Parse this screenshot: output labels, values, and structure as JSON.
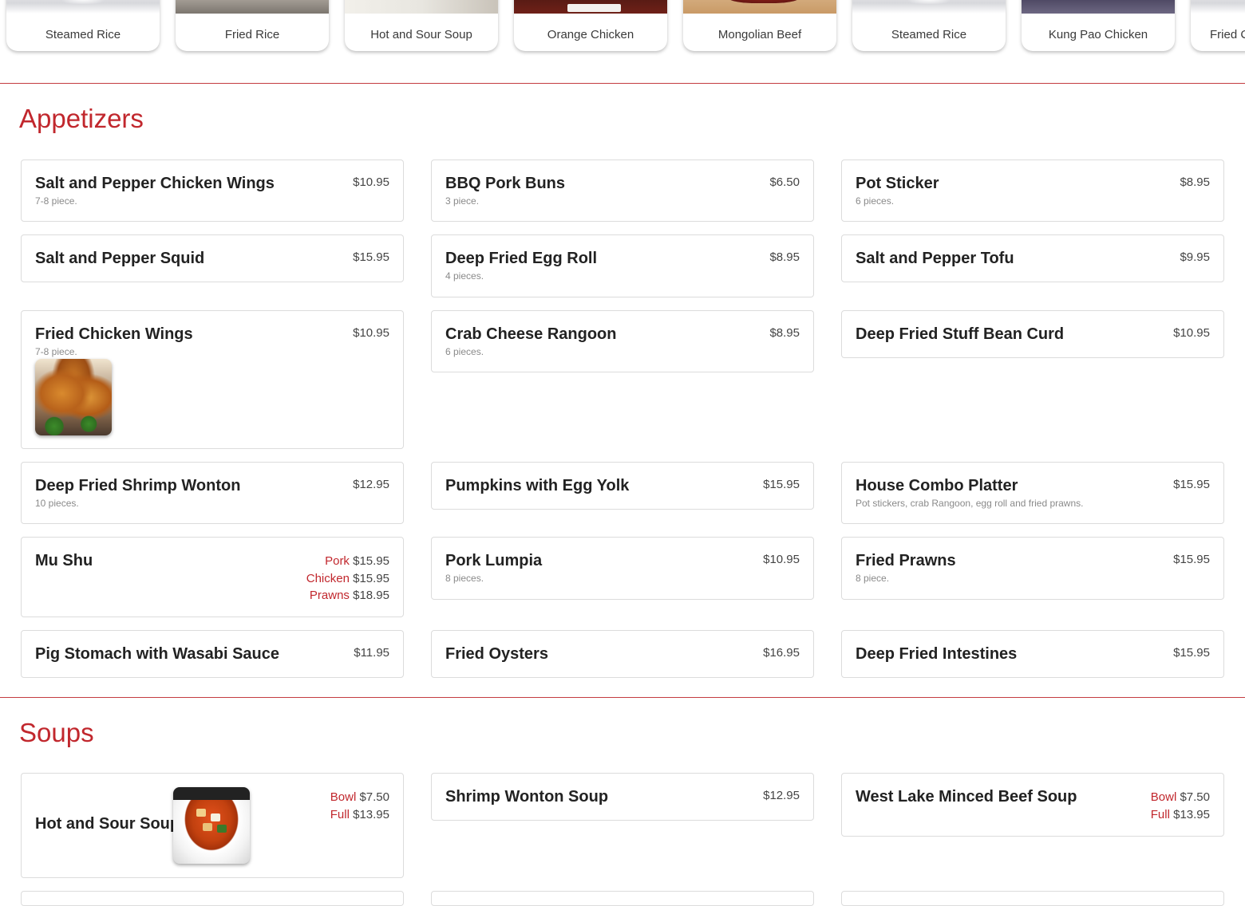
{
  "carousel": {
    "items": [
      {
        "label": "Steamed Rice",
        "thumb": "plate"
      },
      {
        "label": "Fried Rice",
        "thumb": "fried"
      },
      {
        "label": "Hot and Sour Soup",
        "thumb": "soup"
      },
      {
        "label": "Orange Chicken",
        "thumb": "orange"
      },
      {
        "label": "Mongolian Beef",
        "thumb": "beef"
      },
      {
        "label": "Steamed Rice",
        "thumb": "plate"
      },
      {
        "label": "Kung Pao Chicken",
        "thumb": "kungpao"
      },
      {
        "label": "Fried C",
        "thumb": "plate"
      }
    ]
  },
  "sections": {
    "appetizers": {
      "title": "Appetizers",
      "items": [
        {
          "name": "Salt and Pepper Chicken Wings",
          "desc": "7-8 piece.",
          "price": "$10.95"
        },
        {
          "name": "BBQ Pork Buns",
          "desc": "3 piece.",
          "price": "$6.50"
        },
        {
          "name": "Pot Sticker",
          "desc": "6 pieces.",
          "price": "$8.95"
        },
        {
          "name": "Salt and Pepper Squid",
          "price": "$15.95"
        },
        {
          "name": "Deep Fried Egg Roll",
          "desc": "4 pieces.",
          "price": "$8.95"
        },
        {
          "name": "Salt and Pepper Tofu",
          "price": "$9.95"
        },
        {
          "name": "Fried Chicken Wings",
          "desc": "7-8 piece.",
          "price": "$10.95",
          "image": "fried-chicken-wings-photo"
        },
        {
          "name": "Crab Cheese Rangoon",
          "desc": "6 pieces.",
          "price": "$8.95"
        },
        {
          "name": "Deep Fried Stuff Bean Curd",
          "price": "$10.95"
        },
        {
          "name": "Deep Fried Shrimp Wonton",
          "desc": "10 pieces.",
          "price": "$12.95"
        },
        {
          "name": "Pumpkins with Egg Yolk",
          "price": "$15.95"
        },
        {
          "name": "House Combo Platter",
          "desc": "Pot stickers, crab Rangoon, egg roll and fried prawns.",
          "price": "$15.95"
        },
        {
          "name": "Mu Shu",
          "options": [
            {
              "label": "Pork",
              "price": "$15.95"
            },
            {
              "label": "Chicken",
              "price": "$15.95"
            },
            {
              "label": "Prawns",
              "price": "$18.95"
            }
          ]
        },
        {
          "name": "Pork Lumpia",
          "desc": "8 pieces.",
          "price": "$10.95"
        },
        {
          "name": "Fried Prawns",
          "desc": "8 piece.",
          "price": "$15.95"
        },
        {
          "name": "Pig Stomach with Wasabi Sauce",
          "price": "$11.95"
        },
        {
          "name": "Fried Oysters",
          "price": "$16.95"
        },
        {
          "name": "Deep Fried Intestines",
          "price": "$15.95"
        }
      ]
    },
    "soups": {
      "title": "Soups",
      "items": [
        {
          "name": "Hot and Sour Soup",
          "image": "hot-and-sour-soup-photo",
          "options": [
            {
              "label": "Bowl",
              "price": "$7.50"
            },
            {
              "label": "Full",
              "price": "$13.95"
            }
          ]
        },
        {
          "name": "Shrimp Wonton Soup",
          "price": "$12.95"
        },
        {
          "name": "West Lake Minced Beef Soup",
          "options": [
            {
              "label": "Bowl",
              "price": "$7.50"
            },
            {
              "label": "Full",
              "price": "$13.95"
            }
          ]
        }
      ]
    }
  },
  "colors": {
    "accent": "#c1272d",
    "divider": "#c43b40",
    "card_border": "#dcdcdc"
  }
}
